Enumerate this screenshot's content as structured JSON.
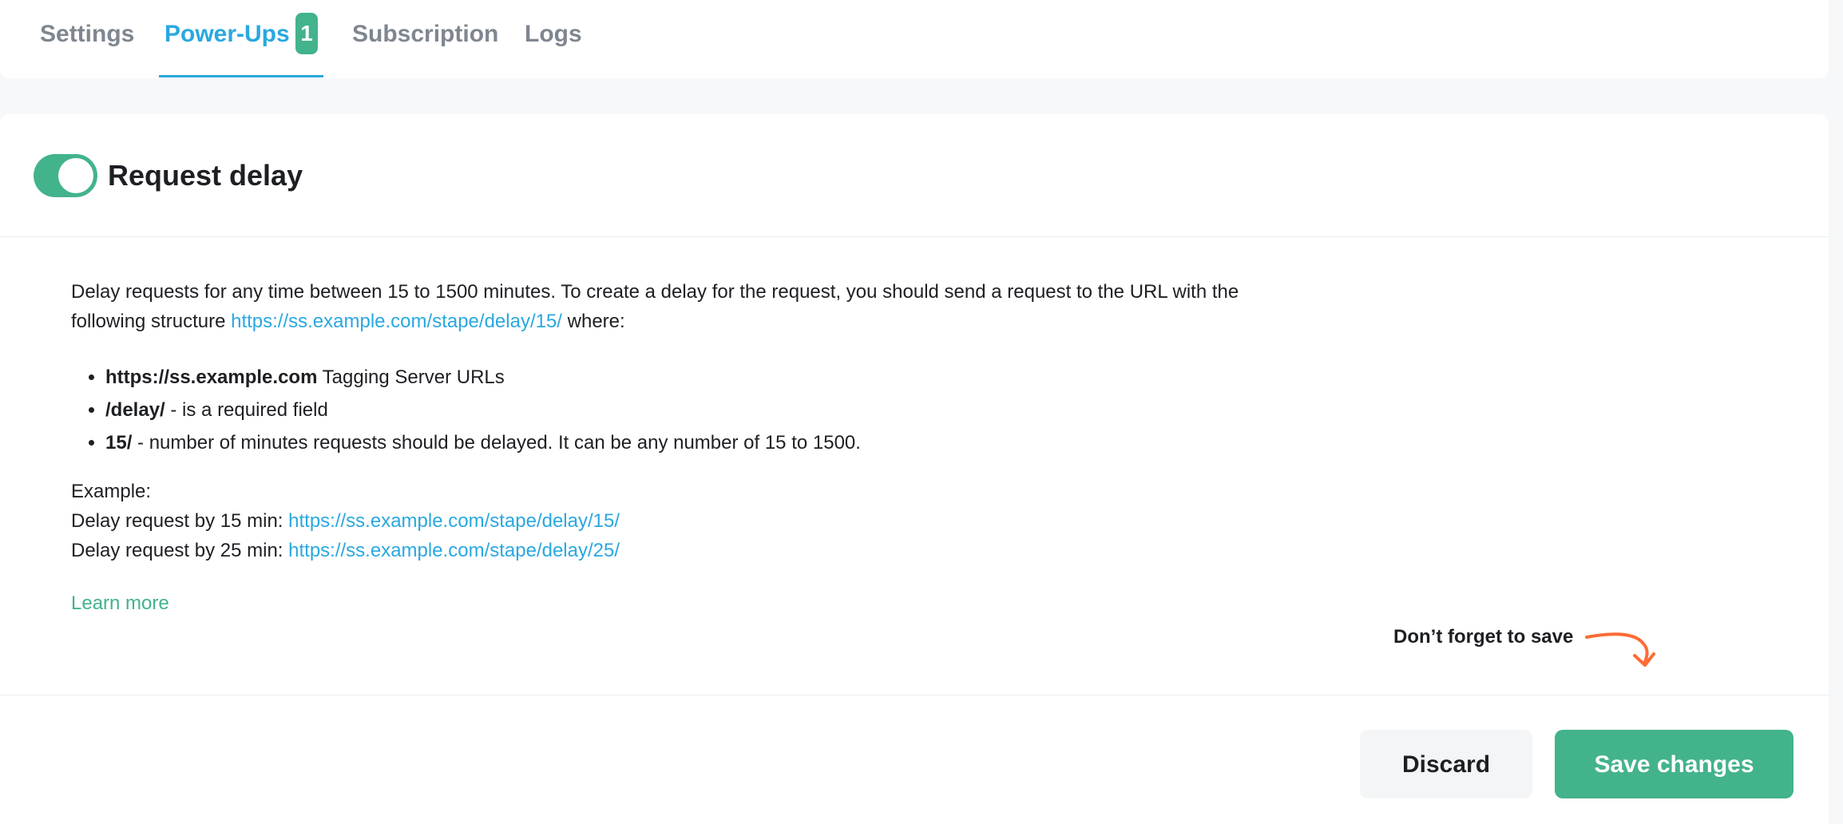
{
  "tabs": {
    "items": [
      {
        "label": "Settings",
        "active": false
      },
      {
        "label": "Power-Ups",
        "active": true,
        "badge": "1"
      },
      {
        "label": "Subscription",
        "active": false
      },
      {
        "label": "Logs",
        "active": false
      }
    ]
  },
  "power_up": {
    "title": "Request delay",
    "enabled": true,
    "description_part1": "Delay requests for any time between 15 to 1500 minutes. To create a delay for the request, you should send a request to the URL with the following structure ",
    "description_link": "https://ss.example.com/stape/delay/15/",
    "description_part2": " where:",
    "bullets": [
      {
        "bold": "https://ss.example.com",
        "text": " Tagging Server URLs"
      },
      {
        "bold": "/delay/",
        "text": " - is a required field"
      },
      {
        "bold": "15/",
        "text": " - number of minutes requests should be delayed. It can be any number of 15 to 1500."
      }
    ],
    "example_heading": "Example:",
    "examples": [
      {
        "label": "Delay request by 15 min: ",
        "url": "https://ss.example.com/stape/delay/15/"
      },
      {
        "label": "Delay request by 25 min: ",
        "url": "https://ss.example.com/stape/delay/25/"
      }
    ],
    "learn_more": "Learn more"
  },
  "footer": {
    "reminder": "Don’t forget to save",
    "discard_label": "Discard",
    "save_label": "Save changes"
  },
  "colors": {
    "accent_green": "#43b38b",
    "link_blue": "#2aa8e0",
    "arrow_orange": "#ff6b35"
  }
}
